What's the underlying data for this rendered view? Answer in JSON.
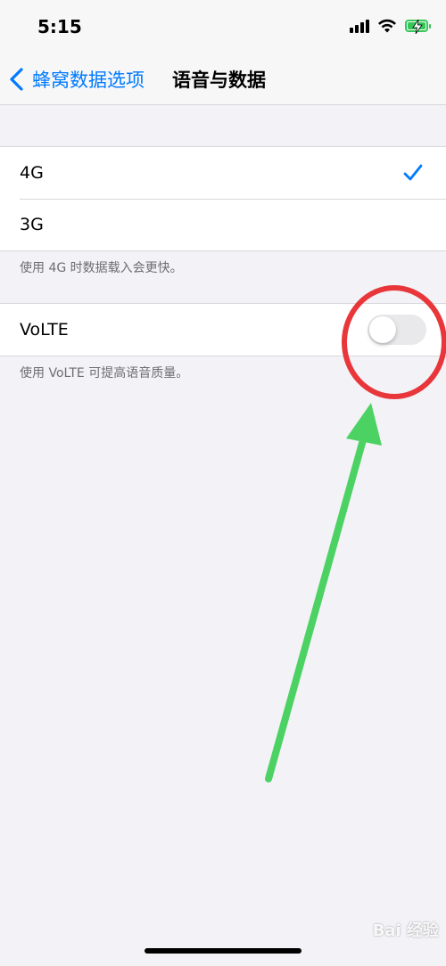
{
  "status_bar": {
    "time": "5:15"
  },
  "nav": {
    "back_label": "蜂窝数据选项",
    "title": "语音与数据"
  },
  "network_group": {
    "items": [
      {
        "label": "4G",
        "selected": true
      },
      {
        "label": "3G",
        "selected": false
      }
    ],
    "footer": "使用 4G 时数据载入会更快。"
  },
  "volte_group": {
    "label": "VoLTE",
    "enabled": false,
    "footer": "使用 VoLTE 可提高语音质量。"
  },
  "colors": {
    "accent": "#007aff",
    "battery": "#34c759",
    "annotation_circle": "#e8363a",
    "annotation_arrow": "#4cd263"
  },
  "watermark": "Bai 经验"
}
